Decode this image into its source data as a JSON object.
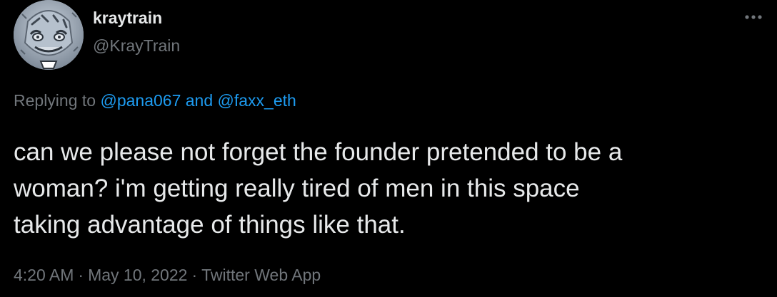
{
  "author": {
    "display_name": "kraytrain",
    "handle": "@KrayTrain"
  },
  "more_icon": "more-horizontal-icon",
  "reply": {
    "prefix": "Replying to ",
    "mention_1": "@pana067",
    "joiner": " and ",
    "mention_2": "@faxx_eth",
    "mention_color": "#1d9bf0"
  },
  "tweet": {
    "text": "can we please not forget the founder pretended to be a\nwoman? i'm getting really tired of men in this space\ntaking advantage of things like that."
  },
  "meta": {
    "time": "4:20 AM",
    "separator_1": "·",
    "date": "May 10, 2022",
    "separator_2": "·",
    "source": "Twitter Web App"
  },
  "colors": {
    "background": "#000000",
    "primary_text": "#e7e9ea",
    "secondary_text": "#71767b",
    "link": "#1d9bf0"
  }
}
